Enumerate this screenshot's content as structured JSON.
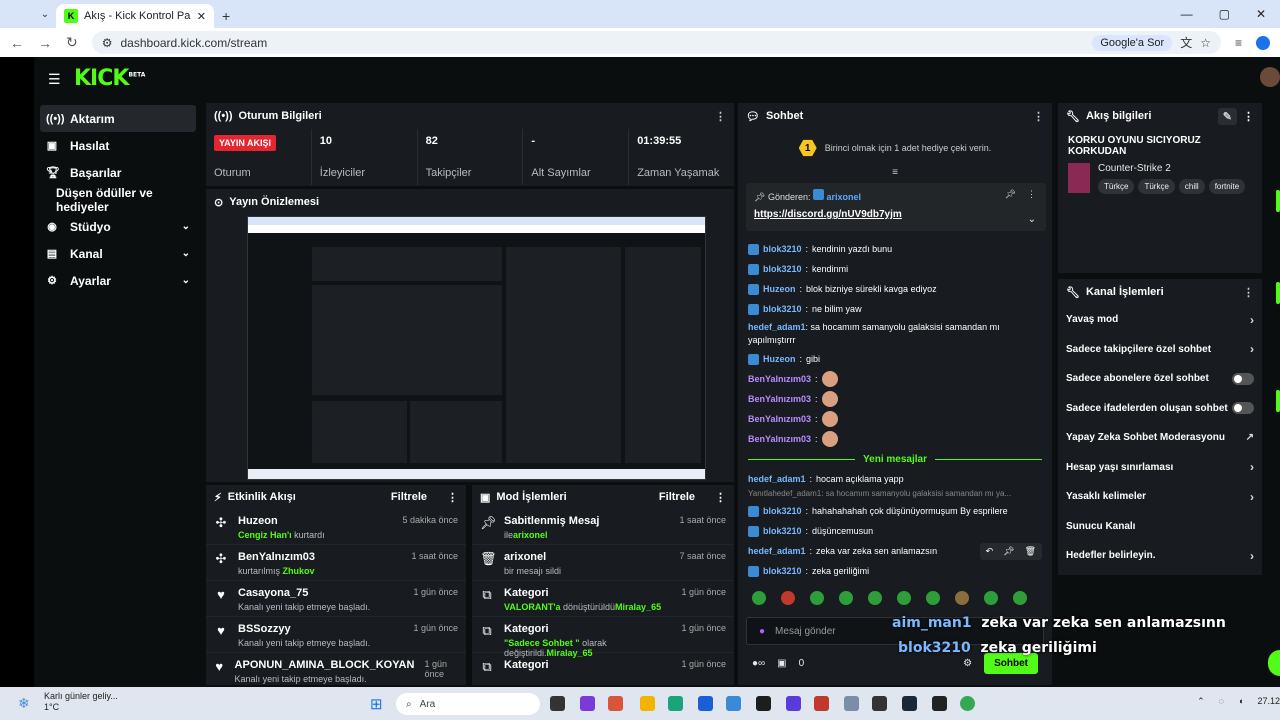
{
  "browser": {
    "tab_title": "Akış - Kick Kontrol Paneli",
    "url": "dashboard.kick.com/stream",
    "google_sor": "Google'a Sor"
  },
  "brand": {
    "logo": "KICK",
    "beta": "BETA",
    "accent": "#53fc18"
  },
  "sidebar": {
    "items": [
      {
        "label": "Aktarım"
      },
      {
        "label": "Hasılat"
      },
      {
        "label": "Başarılar"
      },
      {
        "label": "Düşen ödüller ve hediyeler"
      },
      {
        "label": "Stüdyo"
      },
      {
        "label": "Kanal"
      },
      {
        "label": "Ayarlar"
      }
    ]
  },
  "session": {
    "title": "Oturum Bilgileri",
    "live_label": "YAYIN AKIŞI",
    "stats": [
      {
        "value": "",
        "label": "Oturum"
      },
      {
        "value": "10",
        "label": "İzleyiciler"
      },
      {
        "value": "82",
        "label": "Takipçiler"
      },
      {
        "value": "-",
        "label": "Alt Sayımlar"
      },
      {
        "value": "01:39:55",
        "label": "Zaman Yaşamak"
      }
    ]
  },
  "preview": {
    "title": "Yayın Önizlemesi"
  },
  "activity": {
    "title": "Etkinlik Akışı",
    "filter": "Filtrele",
    "items": [
      {
        "name": "Huzeon",
        "desc_hl": "Cengiz Han'ı",
        "desc": "kurtardı",
        "time": "5 dakika önce"
      },
      {
        "name": "BenYalnızım03",
        "desc": "kurtarılmış",
        "desc_hl": "Zhukov",
        "time": "1 saat önce"
      },
      {
        "name": "Casayona_75",
        "desc": "Kanalı yeni takip etmeye başladı.",
        "time": "1 gün önce"
      },
      {
        "name": "BSSozzyy",
        "desc": "Kanalı yeni takip etmeye başladı.",
        "time": "1 gün önce"
      },
      {
        "name": "APONUN_AMINA_BLOCK_KOYAN",
        "desc": "Kanalı yeni takip etmeye başladı.",
        "time": "1 gün önce"
      }
    ]
  },
  "mod": {
    "title": "Mod İşlemleri",
    "filter": "Filtrele",
    "items": [
      {
        "name": "Sabitlenmiş Mesaj",
        "desc": "ile",
        "desc_hl": "arixonel",
        "time": "1 saat önce"
      },
      {
        "name": "arixonel",
        "desc": "bir mesajı sildi",
        "time": "7 saat önce"
      },
      {
        "name": "Kategori",
        "desc_hl": "VALORANT'a",
        "desc": "dönüştürüldü",
        "desc_hl2": "Miralay_65",
        "time": "1 gün önce"
      },
      {
        "name": "Kategori",
        "desc_hl": "\"Sadece Sohbet \"",
        "desc": "olarak değiştirildi.",
        "desc_hl2": "Miralay_65",
        "time": "1 gün önce"
      },
      {
        "name": "Kategori",
        "desc": "",
        "time": "1 gün önce"
      }
    ]
  },
  "chat": {
    "title": "Sohbet",
    "gift_text": "Birinci olmak için 1 adet hediye çeki verin.",
    "gift_count": "1",
    "pinned_from_label": "Gönderen:",
    "pinned_from": "arixonel",
    "pinned_link": "https://discord.gg/nUV9db7yjm",
    "messages": [
      {
        "user": "blok3210",
        "text": "kendinin yazdı bunu",
        "color": "blue"
      },
      {
        "user": "blok3210",
        "text": "kendinmi",
        "color": "blue"
      },
      {
        "user": "Huzeon",
        "text": "blok bizniye sürekli kavga ediyoz",
        "color": "blue"
      },
      {
        "user": "blok3210",
        "text": "ne bilim yaw",
        "color": "blue"
      },
      {
        "user": "hedef_adam1",
        "text": "sa hocamım samanyolu galaksisi samandan mı yapılmıştırrr",
        "color": "blue"
      },
      {
        "user": "Huzeon",
        "text": "gibi",
        "color": "blue"
      },
      {
        "user": "BenYalnızım03",
        "text": "",
        "color": "purple"
      },
      {
        "user": "BenYalnızım03",
        "text": "",
        "color": "purple"
      },
      {
        "user": "BenYalnızım03",
        "text": "",
        "color": "purple"
      },
      {
        "user": "BenYalnızım03",
        "text": "",
        "color": "purple"
      }
    ],
    "new_label": "Yeni mesajlar",
    "new_messages": [
      {
        "user": "hedef_adam1",
        "text": "hocam açıklama yapp",
        "color": "blue"
      },
      {
        "reply": "Yanıtlahedef_adam1: sa hocamım samanyolu galaksisi samandan mı ya..."
      },
      {
        "user": "blok3210",
        "text": "hahahahahah çok düşünüyormuşum By esprilere",
        "color": "blue"
      },
      {
        "user": "blok3210",
        "text": "düşüncemusun",
        "color": "blue"
      },
      {
        "user": "hedef_adam1",
        "text": "zeka var zeka sen anlamazsın",
        "color": "blue"
      },
      {
        "user": "blok3210",
        "text": "zeka geriliğimi",
        "color": "blue"
      }
    ],
    "input_placeholder": "Mesaj gönder",
    "points": "0",
    "send": "Sohbet"
  },
  "stream_info": {
    "title": "Akış bilgileri",
    "stream_title": "KORKU OYUNU SICIYORUZ KORKUDAN",
    "category": "Counter-Strike 2",
    "tags": [
      "Türkçe",
      "Türkçe",
      "chill",
      "fortnite"
    ]
  },
  "channel_actions": {
    "title": "Kanal İşlemleri",
    "items": [
      {
        "label": "Yavaş mod",
        "ctl": "chevron"
      },
      {
        "label": "Sadece takipçilere özel sohbet",
        "ctl": "chevron"
      },
      {
        "label": "Sadece abonelere özel sohbet",
        "ctl": "toggle"
      },
      {
        "label": "Sadece ifadelerden oluşan sohbet",
        "ctl": "toggle"
      },
      {
        "label": "Yapay Zeka Sohbet Moderasyonu",
        "ctl": "ext"
      },
      {
        "label": "Hesap yaşı sınırlaması",
        "ctl": "chevron"
      },
      {
        "label": "Yasaklı kelimeler",
        "ctl": "chevron"
      },
      {
        "label": "Sunucu Kanalı",
        "ctl": "none"
      },
      {
        "label": "Hedefler belirleyin.",
        "ctl": "chevron"
      }
    ]
  },
  "overlay": [
    {
      "user": "aim_man1",
      "text": "zeka var zeka sen anlamazsınn"
    },
    {
      "user": "blok3210",
      "text": "zeka geriliğimi"
    }
  ],
  "taskbar": {
    "weather": "Karlı günler geliy...",
    "temp": "1°C",
    "search": "Ara",
    "time": "27.12"
  }
}
